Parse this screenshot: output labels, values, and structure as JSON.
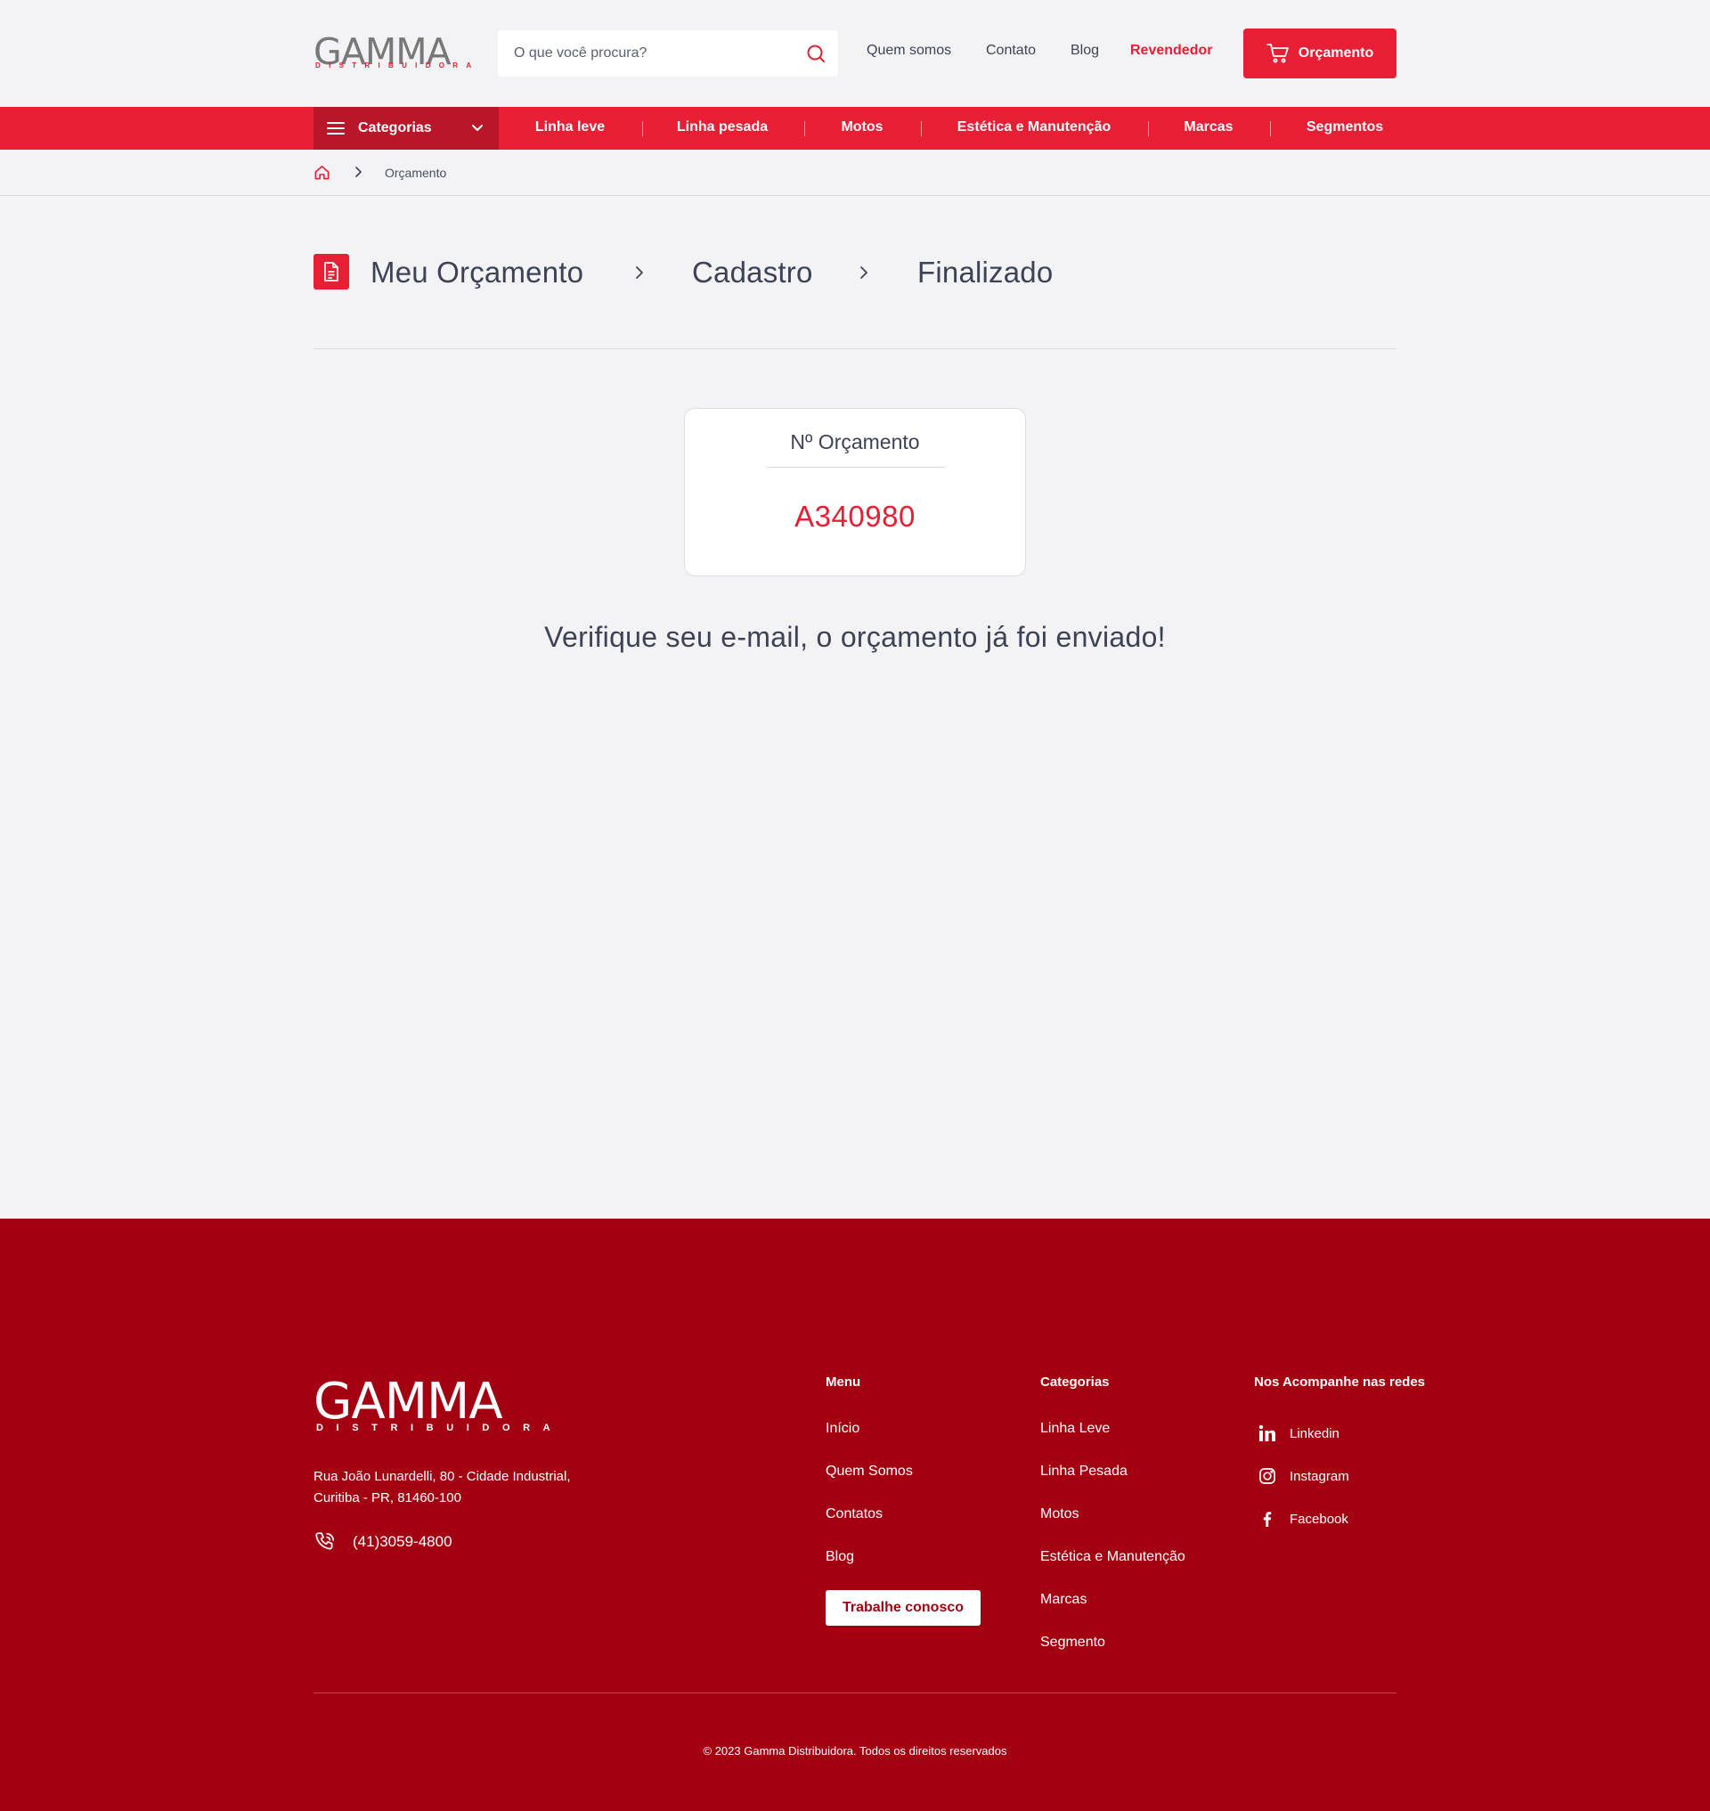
{
  "header": {
    "logo_text": "GAMMA",
    "logo_sub": "DISTRIBUIDORA",
    "search_placeholder": "O que você procura?",
    "nav": [
      "Quem somos",
      "Contato",
      "Blog",
      "Revendedor"
    ],
    "cart_button": "Orçamento"
  },
  "catbar": {
    "categories_label": "Categorias",
    "links": [
      "Linha leve",
      "Linha pesada",
      "Motos",
      "Estética e Manutenção",
      "Marcas",
      "Segmentos"
    ]
  },
  "breadcrumb": {
    "current": "Orçamento"
  },
  "steps": [
    "Meu Orçamento",
    "Cadastro",
    "Finalizado"
  ],
  "card": {
    "title": "Nº Orçamento",
    "number": "A340980"
  },
  "confirm_message": "Verifique seu e-mail, o orçamento já foi enviado!",
  "footer": {
    "logo_text": "GAMMA",
    "logo_sub": "DISTRIBUIDORA",
    "address_line1": "Rua João Lunardelli, 80 - Cidade Industrial,",
    "address_line2": "Curitiba - PR, 81460-100",
    "phone": "(41)3059-4800",
    "menu_title": "Menu",
    "menu": [
      "Início",
      "Quem Somos",
      "Contatos",
      "Blog"
    ],
    "work_button": "Trabalhe conosco",
    "categories_title": "Categorias",
    "categories": [
      "Linha Leve",
      "Linha Pesada",
      "Motos",
      "Estética e Manutenção",
      "Marcas",
      "Segmento"
    ],
    "social_title": "Nos Acompanhe nas redes",
    "social": [
      {
        "label": "Linkedin",
        "icon": "linkedin-icon"
      },
      {
        "label": "Instagram",
        "icon": "instagram-icon"
      },
      {
        "label": "Facebook",
        "icon": "facebook-icon"
      }
    ],
    "copyright": "© 2023 Gamma Distribuidora. Todos os direitos reservados"
  },
  "colors": {
    "brand_red": "#e81e34",
    "footer_red": "#a30011",
    "text_dark": "#3d4256",
    "background": "#f3f3f5"
  }
}
